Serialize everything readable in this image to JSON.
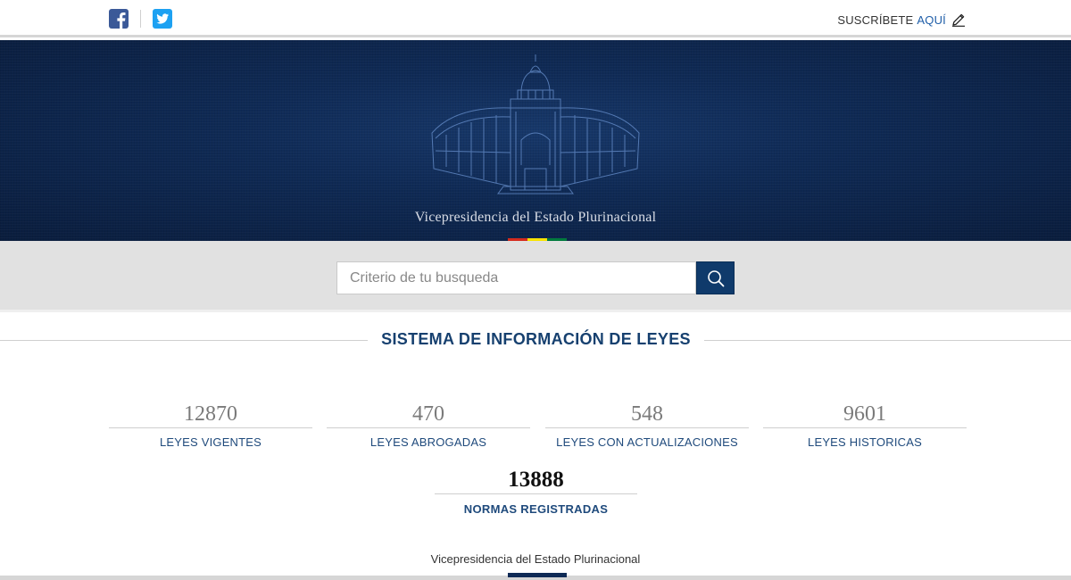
{
  "topbar": {
    "facebook_icon": "facebook-icon",
    "twitter_icon": "twitter-icon",
    "subscribe_label": "SUSCRÍBETE",
    "subscribe_link": "AQUÍ",
    "pencil_icon": "pencil-icon"
  },
  "hero": {
    "title": "Vicepresidencia del Estado Plurinacional",
    "flag_colors": [
      "#d52b1e",
      "#f9e300",
      "#007a3d"
    ]
  },
  "search": {
    "placeholder": "Criterio de tu busqueda",
    "button_icon": "search-icon"
  },
  "section": {
    "title": "SISTEMA DE INFORMACIÓN DE LEYES"
  },
  "stats": [
    {
      "value": "12870",
      "label": "LEYES VIGENTES"
    },
    {
      "value": "470",
      "label": "LEYES ABROGADAS"
    },
    {
      "value": "548",
      "label": "LEYES CON ACTUALIZACIONES"
    },
    {
      "value": "9601",
      "label": "LEYES HISTORICAS"
    }
  ],
  "total": {
    "value": "13888",
    "label": "NORMAS REGISTRADAS"
  },
  "footer": {
    "text": "Vicepresidencia del Estado Plurinacional"
  },
  "colors": {
    "brand_navy": "#0f3a6b",
    "link_blue": "#1f5ea8",
    "title_blue": "#16406f"
  }
}
